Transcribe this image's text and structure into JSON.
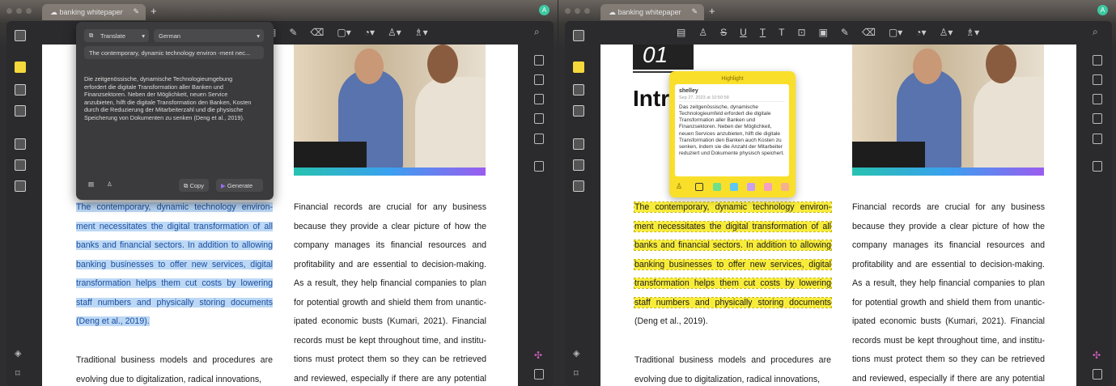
{
  "tab_title": "banking whitepaper",
  "avatar_initial": "A",
  "translate_popup": {
    "mode": "Translate",
    "language": "German",
    "source_text": "The contemporary, dynamic technology environ -ment nec...",
    "output": "Die zeitgenössische, dynamische Technologieumgebung erfordert die digitale Transformation aller Banken und Finanzsektoren. Neben der Möglichkeit, neuen Service anzubieten, hilft die digitale Transformation den Banken, Kosten durch die Reduzierung der Mitarbeiterzahl und die physische Speicherung von Dokumenten zu senken (Deng et al., 2019).",
    "copy_label": "Copy",
    "generate_label": "Generate"
  },
  "highlight_note": {
    "title": "Highlight",
    "author": "shelley",
    "timestamp": "Sep 27, 2023 at 10:50:58",
    "text": "Das zeitgenössische, dynamische Technologieumfeld erfordert die digitale Transformation aller Banken und Finanzsektoren. Neben der Möglichkeit, neuen Services anzubieten, hilft die digitale Transformation den Banken auch Kosten zu senken, indem sie die Anzahl der Mitarbeiter reduziert und Dokumente physisch speichert.",
    "colors": [
      "#ffffff",
      "#6ee08a",
      "#5ec8f0",
      "#c9a0f0",
      "#f5a0c0",
      "#f5b090"
    ]
  },
  "section_number": "01",
  "section_heading": "Intr",
  "left_col": [
    "The contemporary, dynamic technology environ-",
    "ment necessitates the digital transformation of all",
    "banks and financial sectors. In addition to allowing",
    "banking businesses to offer new services, digital",
    "transformation helps them cut costs by lowering",
    "staff numbers and physically storing documents",
    "(Deng et al., 2019)."
  ],
  "left_col2": [
    "Traditional business models and procedures are",
    "evolving due to digitalization, radical innovations,"
  ],
  "right_col": [
    "Financial records are crucial for any business",
    "because they provide a clear picture of how the",
    "company manages its financial resources and",
    "profitability and are essential to decision-making.",
    "As a result, they help financial companies to plan",
    "for potential growth and shield them from unantic-",
    "ipated economic busts (Kumari, 2021). Financial",
    "records must be kept throughout time, and institu-",
    "tions must protect them so they can be retrieved",
    "and reviewed, especially if there are any potential"
  ]
}
